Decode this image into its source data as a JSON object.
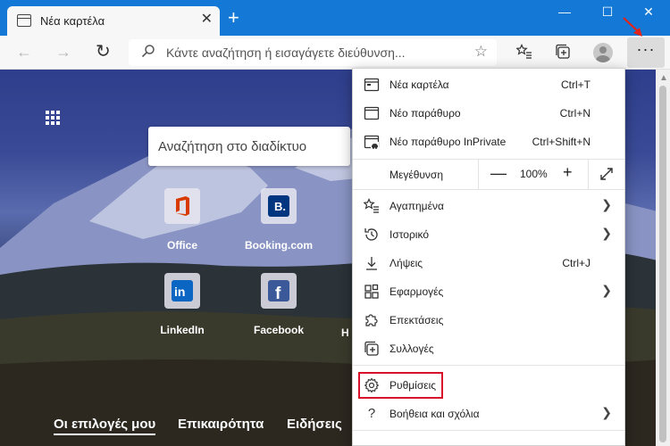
{
  "tab": {
    "title": "Νέα καρτέλα",
    "close": "✕"
  },
  "newtab_symbol": "+",
  "window": {
    "minimize": "—",
    "maximize": "☐",
    "close": "✕"
  },
  "address": {
    "placeholder": "Κάντε αναζήτηση ή εισαγάγετε διεύθυνση..."
  },
  "web_search": {
    "placeholder": "Αναζήτηση στο διαδίκτυο"
  },
  "top_sites": [
    {
      "label": "Office",
      "icon": "office-icon",
      "color": "#d83b01"
    },
    {
      "label": "Booking.com",
      "icon": "booking-icon",
      "color": "#003580"
    },
    {
      "label": "LinkedIn",
      "icon": "linkedin-icon",
      "color": "#0a66c2"
    },
    {
      "label": "Facebook",
      "icon": "facebook-icon",
      "color": "#3b5998"
    }
  ],
  "peek_letter": "H",
  "feed_tabs": [
    "Οι επιλογές μου",
    "Επικαιρότητα",
    "Ειδήσεις"
  ],
  "menu": {
    "new_tab": {
      "label": "Νέα καρτέλα",
      "shortcut": "Ctrl+T"
    },
    "new_window": {
      "label": "Νέο παράθυρο",
      "shortcut": "Ctrl+N"
    },
    "new_inprivate": {
      "label": "Νέο παράθυρο InPrivate",
      "shortcut": "Ctrl+Shift+N"
    },
    "zoom": {
      "label": "Μεγέθυνση",
      "minus": "—",
      "value": "100%",
      "plus": "+"
    },
    "favorites": {
      "label": "Αγαπημένα"
    },
    "history": {
      "label": "Ιστορικό"
    },
    "downloads": {
      "label": "Λήψεις",
      "shortcut": "Ctrl+J"
    },
    "apps": {
      "label": "Εφαρμογές"
    },
    "extensions": {
      "label": "Επεκτάσεις"
    },
    "collections": {
      "label": "Συλλογές"
    },
    "settings": {
      "label": "Ρυθμίσεις"
    },
    "help": {
      "label": "Βοήθεια και σχόλια"
    }
  },
  "colors": {
    "titlebar": "#1378d6",
    "highlight": "#d9102a",
    "arrow": "#e0241b"
  }
}
